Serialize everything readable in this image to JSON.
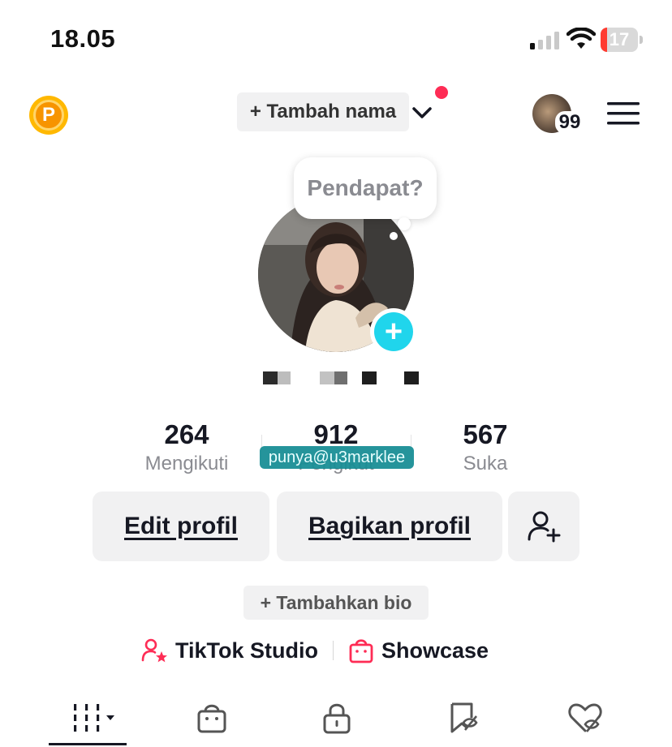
{
  "status_bar": {
    "time": "18.05",
    "battery_level": "17",
    "battery_fraction": 0.17
  },
  "header": {
    "coin_label": "P",
    "add_name_label": "+ Tambah nama",
    "notification_count": "99",
    "colors": {
      "accent": "#fe2c55",
      "coin": "#ffb800",
      "add_avatar": "#20d5ec"
    }
  },
  "profile": {
    "tooltip": "Pendapat?",
    "add_avatar_symbol": "+",
    "watermark": "punya@u3marklee"
  },
  "stats": {
    "following": {
      "value": "264",
      "label": "Mengikuti"
    },
    "followers": {
      "value": "912",
      "label": "Pengikut"
    },
    "likes": {
      "value": "567",
      "label": "Suka"
    }
  },
  "actions": {
    "edit_profile": "Edit profil",
    "share_profile": "Bagikan profil",
    "add_bio": "+ Tambahkan bio"
  },
  "links": {
    "studio": "TikTok Studio",
    "showcase": "Showcase"
  },
  "tabs": [
    {
      "icon": "grid-icon",
      "selected": true
    },
    {
      "icon": "shopping-bag-icon",
      "selected": false
    },
    {
      "icon": "lock-icon",
      "selected": false
    },
    {
      "icon": "repost-icon",
      "selected": false
    },
    {
      "icon": "liked-icon",
      "selected": false
    }
  ]
}
